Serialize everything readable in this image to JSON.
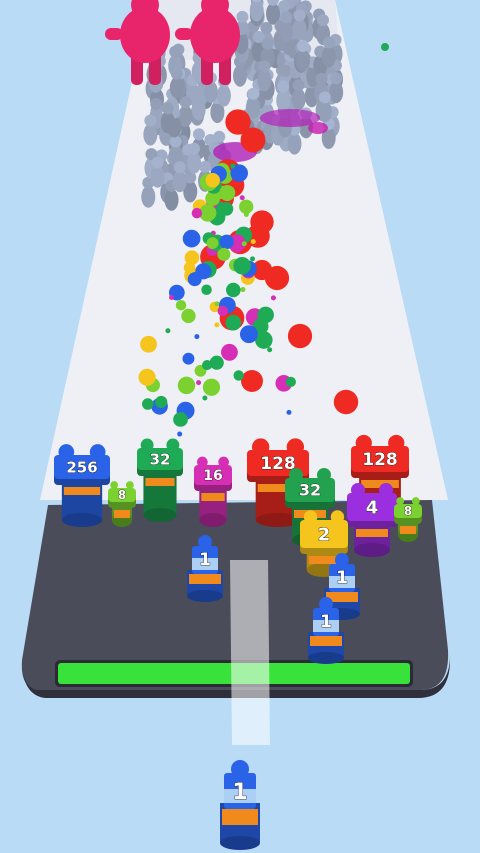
{
  "scene": {
    "sky_color": "#b9dbf6",
    "runway_color": "#eef0f5",
    "platform_color": "#4a4c5a",
    "progress_bar_color": "#39e23a",
    "progress": 1.0
  },
  "stacks": [
    {
      "label": "256",
      "color": "#2a62e8"
    },
    {
      "label": "8",
      "color": "#7ad12f"
    },
    {
      "label": "32",
      "color": "#1faa55"
    },
    {
      "label": "16",
      "color": "#d62fb5"
    },
    {
      "label": "128",
      "color": "#ee2a22"
    },
    {
      "label": "32",
      "color": "#22a24f"
    },
    {
      "label": "128",
      "color": "#ee2a22"
    },
    {
      "label": "4",
      "color": "#9b2fe0"
    },
    {
      "label": "8",
      "color": "#7ad12f"
    },
    {
      "label": "2",
      "color": "#f5c51d"
    }
  ],
  "pieces": [
    {
      "label": "1",
      "color": "#2a62e8"
    },
    {
      "label": "1",
      "color": "#2a62e8"
    },
    {
      "label": "1",
      "color": "#2a62e8"
    },
    {
      "label": "1",
      "color": "#2a62e8"
    }
  ],
  "player": {
    "label": "1",
    "color": "#2a62e8"
  },
  "crowd": {
    "colors": [
      "#9aa6bf",
      "#e8246a"
    ]
  }
}
